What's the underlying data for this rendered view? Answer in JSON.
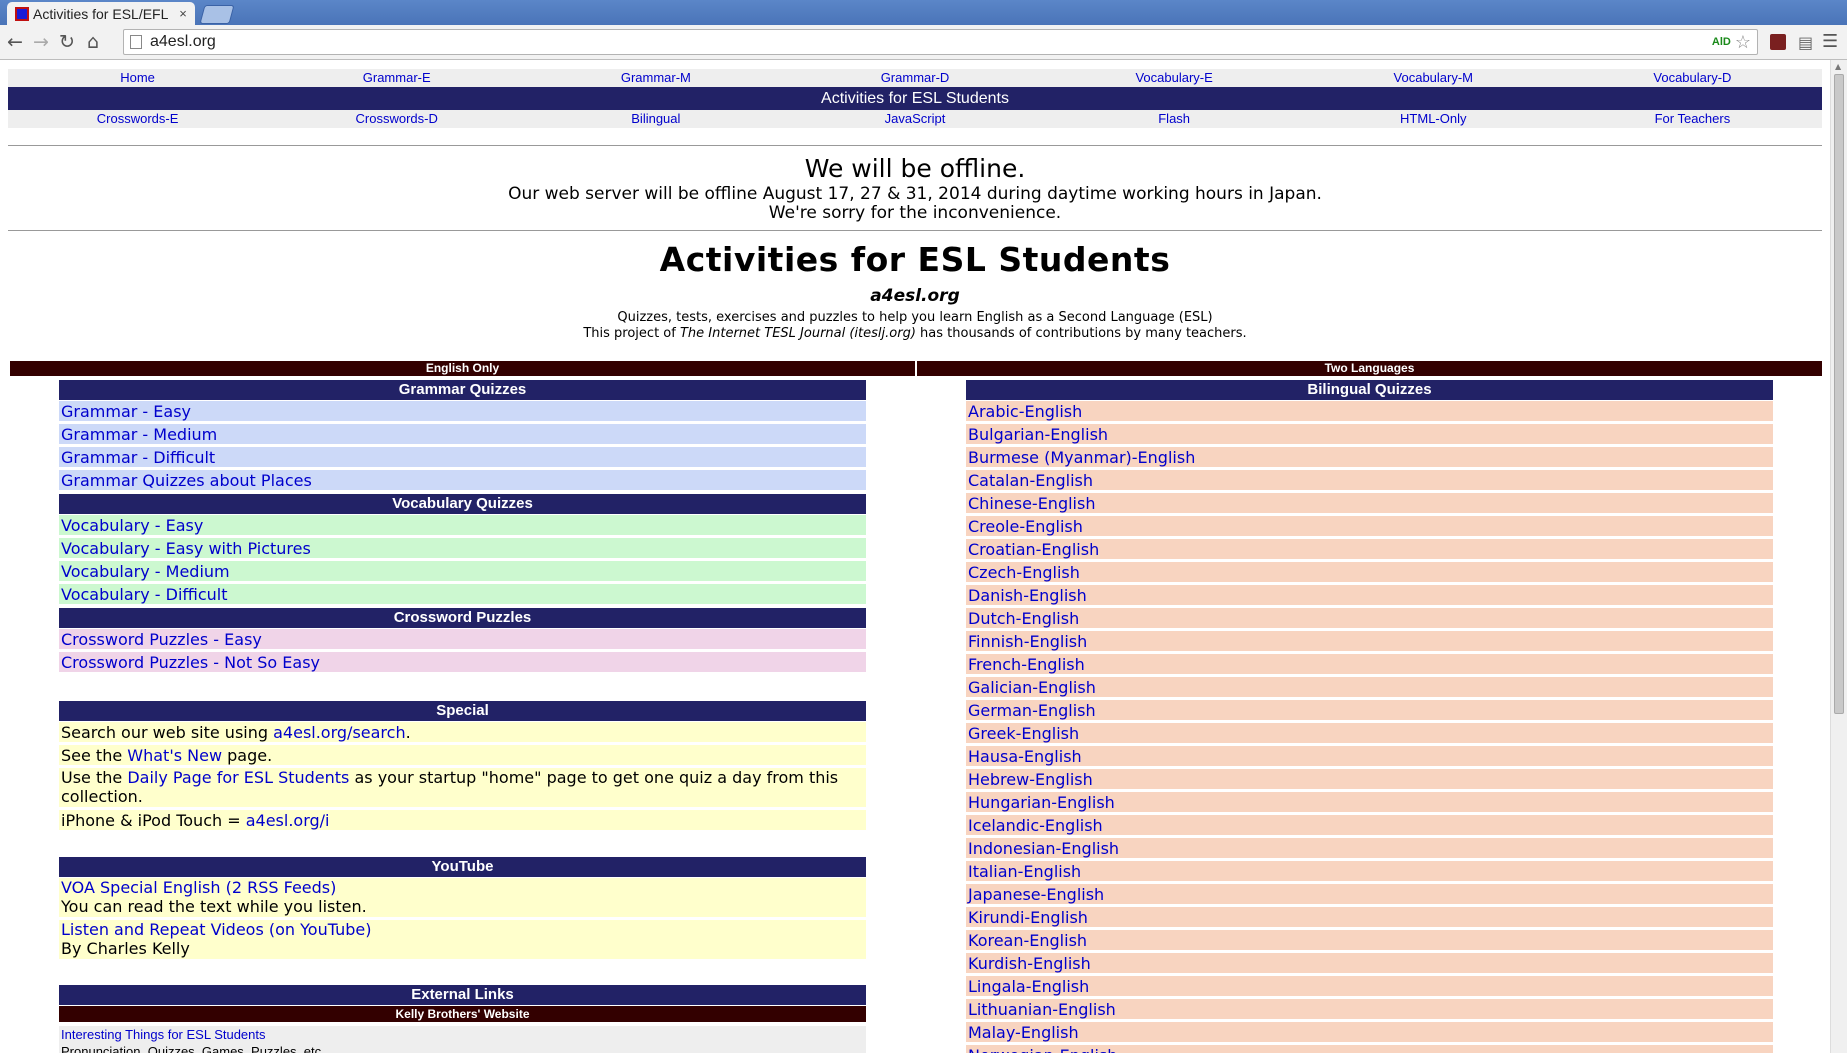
{
  "browser": {
    "tab_title": "Activities for ESL/EFL",
    "tab_close": "×",
    "url": "a4esl.org",
    "ald_badge": "AlD",
    "back": "←",
    "forward": "→",
    "reload": "↻",
    "home": "⌂",
    "star": "☆",
    "menu": "☰"
  },
  "nav_top": [
    "Home",
    "Grammar-E",
    "Grammar-M",
    "Grammar-D",
    "Vocabulary-E",
    "Vocabulary-M",
    "Vocabulary-D"
  ],
  "banner": "Activities for ESL Students",
  "nav_bottom": [
    "Crosswords-E",
    "Crosswords-D",
    "Bilingual",
    "JavaScript",
    "Flash",
    "HTML-Only",
    "For Teachers"
  ],
  "notice": {
    "title": "We will be offline.",
    "line1": "Our web server will be offline August 17, 27 & 31, 2014 during daytime working hours in Japan.",
    "line2": "We're sorry for the inconvenience."
  },
  "site": {
    "title": "Activities for ESL Students",
    "subtitle": "a4esl.org",
    "desc1": "Quizzes, tests, exercises and puzzles to help you learn English as a Second Language (ESL)",
    "desc2_pre": "This project of ",
    "desc2_em": "The Internet TESL Journal (iteslj.org)",
    "desc2_post": " has thousands of contributions by many teachers."
  },
  "left": {
    "header": "English Only",
    "grammar_head": "Grammar Quizzes",
    "grammar": [
      "Grammar - Easy",
      "Grammar - Medium",
      "Grammar - Difficult",
      "Grammar Quizzes about Places"
    ],
    "vocab_head": "Vocabulary Quizzes",
    "vocab": [
      "Vocabulary - Easy",
      "Vocabulary - Easy with Pictures",
      "Vocabulary - Medium",
      "Vocabulary - Difficult"
    ],
    "cross_head": "Crossword Puzzles",
    "cross": [
      "Crossword Puzzles - Easy",
      "Crossword Puzzles - Not So Easy"
    ],
    "special_head": "Special",
    "special": {
      "s1_pre": "Search our web site using ",
      "s1_link": "a4esl.org/search",
      "s1_post": ".",
      "s2_pre": "See the ",
      "s2_link": "What's New",
      "s2_post": " page.",
      "s3_pre": "Use the ",
      "s3_link": "Daily Page for ESL Students",
      "s3_post": " as your startup \"home\" page to get one quiz a day from this collection.",
      "s4_pre": "iPhone & iPod Touch = ",
      "s4_link": "a4esl.org/i"
    },
    "youtube_head": "YouTube",
    "youtube": {
      "y1_link": "VOA Special English (2 RSS Feeds)",
      "y1_text": "You can read the text while you listen.",
      "y2_link": "Listen and Repeat Videos (on YouTube)",
      "y2_text": "By Charles Kelly"
    },
    "external_head": "External Links",
    "kelly_head": "Kelly Brothers' Website",
    "ext1_link": "Interesting Things for ESL Students",
    "ext1_text": "Pronunciation, Quizzes, Games, Puzzles, etc."
  },
  "right": {
    "header": "Two Languages",
    "bilingual_head": "Bilingual Quizzes",
    "languages": [
      "Arabic-English",
      "Bulgarian-English",
      "Burmese (Myanmar)-English",
      "Catalan-English",
      "Chinese-English",
      "Creole-English",
      "Croatian-English",
      "Czech-English",
      "Danish-English",
      "Dutch-English",
      "Finnish-English",
      "French-English",
      "Galician-English",
      "German-English",
      "Greek-English",
      "Hausa-English",
      "Hebrew-English",
      "Hungarian-English",
      "Icelandic-English",
      "Indonesian-English",
      "Italian-English",
      "Japanese-English",
      "Kirundi-English",
      "Korean-English",
      "Kurdish-English",
      "Lingala-English",
      "Lithuanian-English",
      "Malay-English",
      "Norwegian-English"
    ]
  }
}
